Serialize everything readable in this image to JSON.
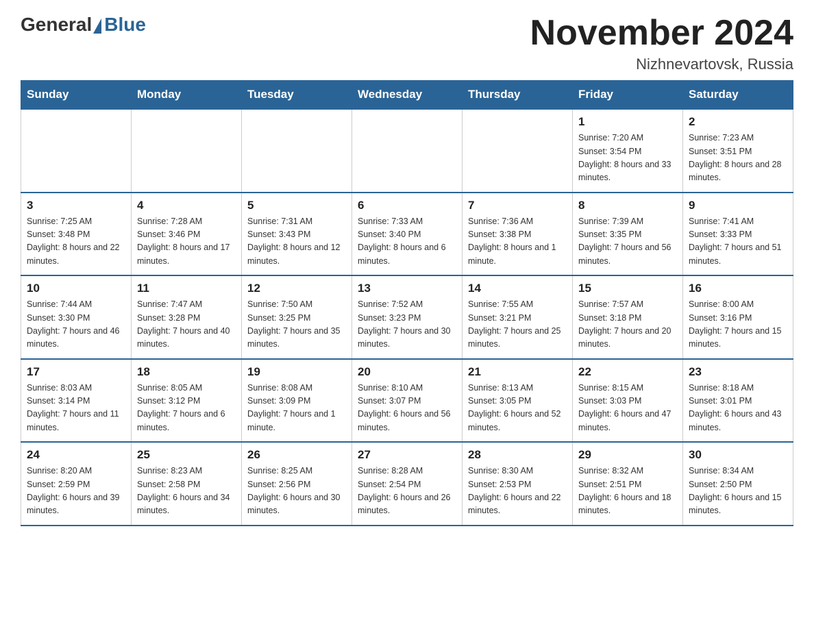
{
  "header": {
    "logo_general": "General",
    "logo_blue": "Blue",
    "month_title": "November 2024",
    "location": "Nizhnevartovsk, Russia"
  },
  "weekdays": [
    "Sunday",
    "Monday",
    "Tuesday",
    "Wednesday",
    "Thursday",
    "Friday",
    "Saturday"
  ],
  "weeks": [
    [
      {
        "day": "",
        "sunrise": "",
        "sunset": "",
        "daylight": "",
        "empty": true
      },
      {
        "day": "",
        "sunrise": "",
        "sunset": "",
        "daylight": "",
        "empty": true
      },
      {
        "day": "",
        "sunrise": "",
        "sunset": "",
        "daylight": "",
        "empty": true
      },
      {
        "day": "",
        "sunrise": "",
        "sunset": "",
        "daylight": "",
        "empty": true
      },
      {
        "day": "",
        "sunrise": "",
        "sunset": "",
        "daylight": "",
        "empty": true
      },
      {
        "day": "1",
        "sunrise": "Sunrise: 7:20 AM",
        "sunset": "Sunset: 3:54 PM",
        "daylight": "Daylight: 8 hours and 33 minutes.",
        "empty": false
      },
      {
        "day": "2",
        "sunrise": "Sunrise: 7:23 AM",
        "sunset": "Sunset: 3:51 PM",
        "daylight": "Daylight: 8 hours and 28 minutes.",
        "empty": false
      }
    ],
    [
      {
        "day": "3",
        "sunrise": "Sunrise: 7:25 AM",
        "sunset": "Sunset: 3:48 PM",
        "daylight": "Daylight: 8 hours and 22 minutes.",
        "empty": false
      },
      {
        "day": "4",
        "sunrise": "Sunrise: 7:28 AM",
        "sunset": "Sunset: 3:46 PM",
        "daylight": "Daylight: 8 hours and 17 minutes.",
        "empty": false
      },
      {
        "day": "5",
        "sunrise": "Sunrise: 7:31 AM",
        "sunset": "Sunset: 3:43 PM",
        "daylight": "Daylight: 8 hours and 12 minutes.",
        "empty": false
      },
      {
        "day": "6",
        "sunrise": "Sunrise: 7:33 AM",
        "sunset": "Sunset: 3:40 PM",
        "daylight": "Daylight: 8 hours and 6 minutes.",
        "empty": false
      },
      {
        "day": "7",
        "sunrise": "Sunrise: 7:36 AM",
        "sunset": "Sunset: 3:38 PM",
        "daylight": "Daylight: 8 hours and 1 minute.",
        "empty": false
      },
      {
        "day": "8",
        "sunrise": "Sunrise: 7:39 AM",
        "sunset": "Sunset: 3:35 PM",
        "daylight": "Daylight: 7 hours and 56 minutes.",
        "empty": false
      },
      {
        "day": "9",
        "sunrise": "Sunrise: 7:41 AM",
        "sunset": "Sunset: 3:33 PM",
        "daylight": "Daylight: 7 hours and 51 minutes.",
        "empty": false
      }
    ],
    [
      {
        "day": "10",
        "sunrise": "Sunrise: 7:44 AM",
        "sunset": "Sunset: 3:30 PM",
        "daylight": "Daylight: 7 hours and 46 minutes.",
        "empty": false
      },
      {
        "day": "11",
        "sunrise": "Sunrise: 7:47 AM",
        "sunset": "Sunset: 3:28 PM",
        "daylight": "Daylight: 7 hours and 40 minutes.",
        "empty": false
      },
      {
        "day": "12",
        "sunrise": "Sunrise: 7:50 AM",
        "sunset": "Sunset: 3:25 PM",
        "daylight": "Daylight: 7 hours and 35 minutes.",
        "empty": false
      },
      {
        "day": "13",
        "sunrise": "Sunrise: 7:52 AM",
        "sunset": "Sunset: 3:23 PM",
        "daylight": "Daylight: 7 hours and 30 minutes.",
        "empty": false
      },
      {
        "day": "14",
        "sunrise": "Sunrise: 7:55 AM",
        "sunset": "Sunset: 3:21 PM",
        "daylight": "Daylight: 7 hours and 25 minutes.",
        "empty": false
      },
      {
        "day": "15",
        "sunrise": "Sunrise: 7:57 AM",
        "sunset": "Sunset: 3:18 PM",
        "daylight": "Daylight: 7 hours and 20 minutes.",
        "empty": false
      },
      {
        "day": "16",
        "sunrise": "Sunrise: 8:00 AM",
        "sunset": "Sunset: 3:16 PM",
        "daylight": "Daylight: 7 hours and 15 minutes.",
        "empty": false
      }
    ],
    [
      {
        "day": "17",
        "sunrise": "Sunrise: 8:03 AM",
        "sunset": "Sunset: 3:14 PM",
        "daylight": "Daylight: 7 hours and 11 minutes.",
        "empty": false
      },
      {
        "day": "18",
        "sunrise": "Sunrise: 8:05 AM",
        "sunset": "Sunset: 3:12 PM",
        "daylight": "Daylight: 7 hours and 6 minutes.",
        "empty": false
      },
      {
        "day": "19",
        "sunrise": "Sunrise: 8:08 AM",
        "sunset": "Sunset: 3:09 PM",
        "daylight": "Daylight: 7 hours and 1 minute.",
        "empty": false
      },
      {
        "day": "20",
        "sunrise": "Sunrise: 8:10 AM",
        "sunset": "Sunset: 3:07 PM",
        "daylight": "Daylight: 6 hours and 56 minutes.",
        "empty": false
      },
      {
        "day": "21",
        "sunrise": "Sunrise: 8:13 AM",
        "sunset": "Sunset: 3:05 PM",
        "daylight": "Daylight: 6 hours and 52 minutes.",
        "empty": false
      },
      {
        "day": "22",
        "sunrise": "Sunrise: 8:15 AM",
        "sunset": "Sunset: 3:03 PM",
        "daylight": "Daylight: 6 hours and 47 minutes.",
        "empty": false
      },
      {
        "day": "23",
        "sunrise": "Sunrise: 8:18 AM",
        "sunset": "Sunset: 3:01 PM",
        "daylight": "Daylight: 6 hours and 43 minutes.",
        "empty": false
      }
    ],
    [
      {
        "day": "24",
        "sunrise": "Sunrise: 8:20 AM",
        "sunset": "Sunset: 2:59 PM",
        "daylight": "Daylight: 6 hours and 39 minutes.",
        "empty": false
      },
      {
        "day": "25",
        "sunrise": "Sunrise: 8:23 AM",
        "sunset": "Sunset: 2:58 PM",
        "daylight": "Daylight: 6 hours and 34 minutes.",
        "empty": false
      },
      {
        "day": "26",
        "sunrise": "Sunrise: 8:25 AM",
        "sunset": "Sunset: 2:56 PM",
        "daylight": "Daylight: 6 hours and 30 minutes.",
        "empty": false
      },
      {
        "day": "27",
        "sunrise": "Sunrise: 8:28 AM",
        "sunset": "Sunset: 2:54 PM",
        "daylight": "Daylight: 6 hours and 26 minutes.",
        "empty": false
      },
      {
        "day": "28",
        "sunrise": "Sunrise: 8:30 AM",
        "sunset": "Sunset: 2:53 PM",
        "daylight": "Daylight: 6 hours and 22 minutes.",
        "empty": false
      },
      {
        "day": "29",
        "sunrise": "Sunrise: 8:32 AM",
        "sunset": "Sunset: 2:51 PM",
        "daylight": "Daylight: 6 hours and 18 minutes.",
        "empty": false
      },
      {
        "day": "30",
        "sunrise": "Sunrise: 8:34 AM",
        "sunset": "Sunset: 2:50 PM",
        "daylight": "Daylight: 6 hours and 15 minutes.",
        "empty": false
      }
    ]
  ]
}
